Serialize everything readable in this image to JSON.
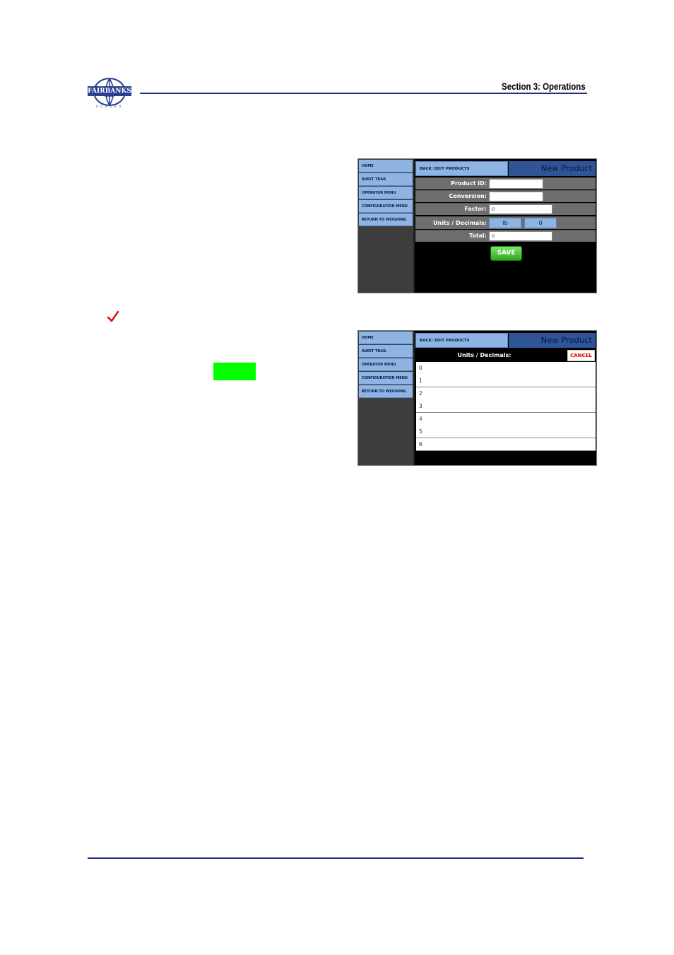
{
  "header": {
    "brand": "FAIRBANKS",
    "brand_sub": "SCALES",
    "section_title": "Section 3: Operations"
  },
  "sidebar": {
    "items": [
      {
        "label": "HOME"
      },
      {
        "label": "AUDIT TRAIL"
      },
      {
        "label": "OPERATOR MENU"
      },
      {
        "label": "CONFIGURATION MENU"
      },
      {
        "label": "RETURN TO WEIGHING"
      }
    ]
  },
  "screen1": {
    "back_label": "BACK: EDIT PRODUCTS",
    "title": "New Product",
    "fields": {
      "product_id": {
        "label": "Product ID:",
        "value": ""
      },
      "conversion": {
        "label": "Conversion:",
        "value": ""
      },
      "factor": {
        "label": "Factor:",
        "value": "0"
      },
      "units_decimals": {
        "label": "Units / Decimals:",
        "units": "lb",
        "decimals": "0"
      },
      "total": {
        "label": "Total:",
        "value": "0"
      }
    },
    "save_label": "SAVE"
  },
  "screen2": {
    "back_label": "BACK: EDIT PRODUCTS",
    "title": "New Product",
    "list_title": "Units / Decimals:",
    "cancel_label": "CANCEL",
    "options": [
      "0",
      "1",
      "2",
      "3",
      "4",
      "5",
      "6"
    ],
    "selected_option": "4"
  },
  "colors": {
    "accent_blue": "#8db4e3",
    "title_bar": "#2f5597",
    "save_green": "#2fa81d",
    "cancel_red": "#e00000",
    "highlight_green": "#00ff00",
    "rule_navy": "#1f2a8a"
  }
}
